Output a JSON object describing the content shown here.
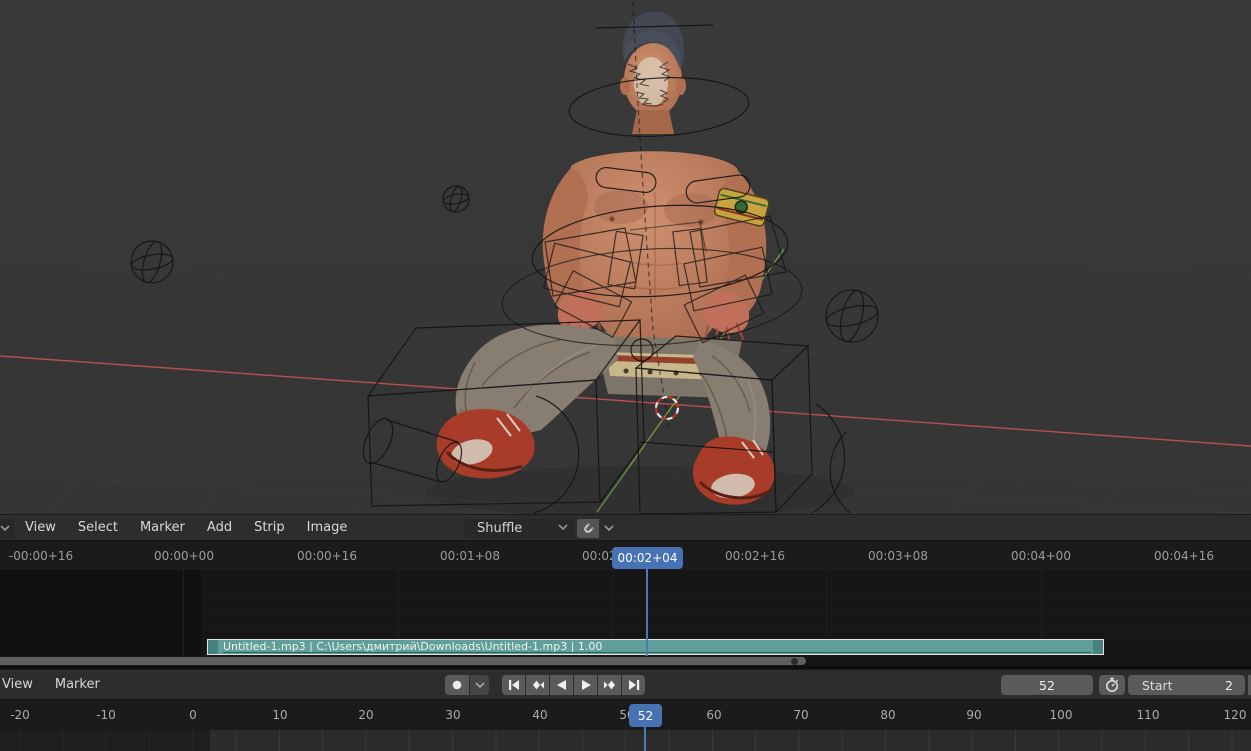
{
  "viewport": {
    "description": "3D viewport with seated shirtless character, armature wireframe bone shapes, red X axis, green Y axis, 3D cursor",
    "axis_x_color": "#c05050",
    "axis_y_color": "#76a43e",
    "background": "#393939"
  },
  "sequencer": {
    "header": {
      "editor_icon": "chevron-down-icon",
      "menus": [
        "View",
        "Select",
        "Marker",
        "Add",
        "Strip",
        "Image"
      ],
      "overlap_mode": "Shuffle",
      "snap_icon": "magnet-icon",
      "snap_options_icon": "chevron-down-icon"
    },
    "ruler": {
      "labels": [
        "-00:00+16",
        "00:00+00",
        "00:00+16",
        "00:01+08",
        "00:02+00",
        "00:02+16",
        "00:03+08",
        "00:04+00",
        "00:04+16"
      ],
      "current_time": "00:02+04"
    },
    "strip": {
      "label": "Untitled-1.mp3 | C:\\Users\\дмитрий\\Downloads\\Untitled-1.mp3 | 1.00",
      "color": "#5f9e99"
    }
  },
  "timeline": {
    "header": {
      "menus": [
        "View",
        "Marker"
      ],
      "record_icon": "record-dot-icon",
      "transport_icons": [
        "jump-to-start-icon",
        "jump-to-prev-keyframe-icon",
        "play-reverse-icon",
        "play-icon",
        "jump-to-next-keyframe-icon",
        "jump-to-end-icon"
      ],
      "current_frame": "52",
      "preview_range_icon": "stopwatch-icon",
      "start_label": "Start",
      "start_value": "2"
    },
    "ruler": {
      "labels": [
        "-20",
        "-10",
        "0",
        "10",
        "20",
        "30",
        "40",
        "50",
        "60",
        "70",
        "80",
        "90",
        "100",
        "110",
        "120"
      ],
      "current_frame": "52"
    }
  },
  "colors": {
    "accent_blue": "#4772b3",
    "strip_teal": "#5f9e99"
  }
}
